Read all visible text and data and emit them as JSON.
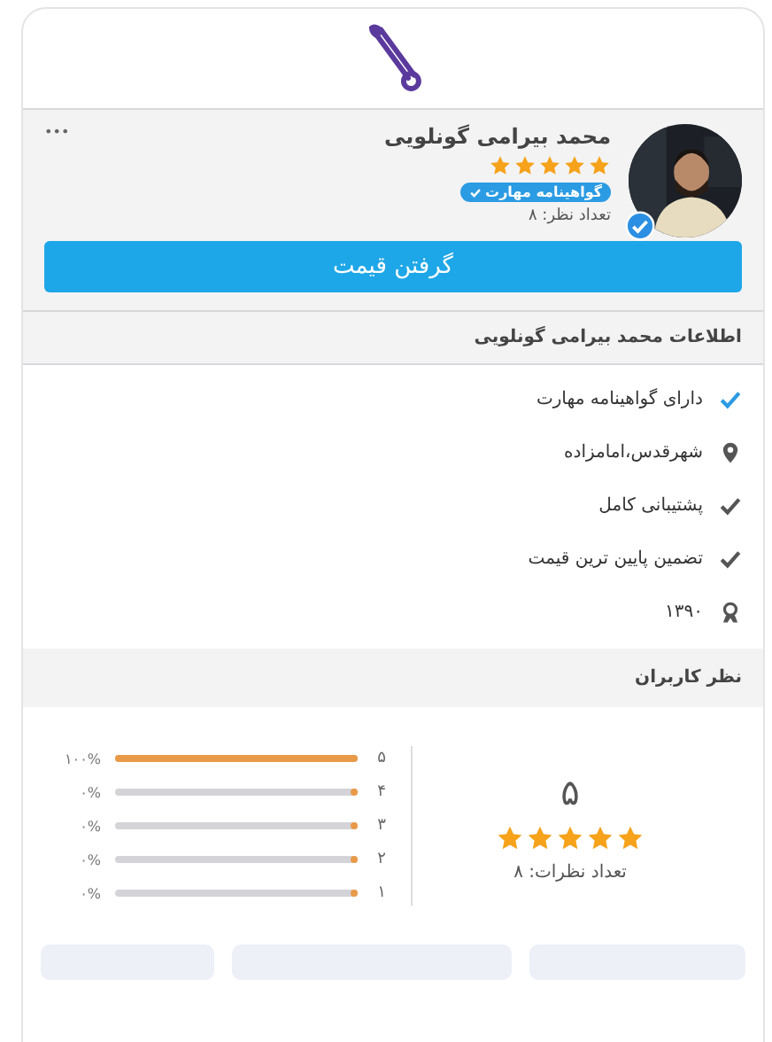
{
  "profile": {
    "name": "محمد بیرامی گونلویی",
    "stars": 5,
    "badge": "گواهینامه مهارت",
    "reviews_count": "تعداد نظر: ۸",
    "verified": true,
    "more": "•••",
    "button": "گرفتن قیمت"
  },
  "info": {
    "title": "اطلاعات محمد بیرامی گونلویی",
    "items": [
      {
        "kind": "verified",
        "text": "دارای گواهینامه مهارت"
      },
      {
        "kind": "location",
        "text": "شهرقدس،امامزاده"
      },
      {
        "kind": "check",
        "text": "پشتیبانی کامل"
      },
      {
        "kind": "check",
        "text": "تضمین پایین ترین قیمت"
      },
      {
        "kind": "since",
        "text": "۱۳۹۰"
      }
    ]
  },
  "reviews": {
    "title": "نظر کاربران",
    "score": "۵",
    "stars": 5,
    "count": "تعداد نظرات: ۸",
    "rows": [
      {
        "label": "۵",
        "level": 1,
        "percent": "۱۰۰%"
      },
      {
        "label": "۴",
        "level": 0,
        "percent": "۰%"
      },
      {
        "label": "۳",
        "level": 0,
        "percent": "۰%"
      },
      {
        "label": "۲",
        "level": 0,
        "percent": "۰%"
      },
      {
        "label": "۱",
        "level": 0,
        "percent": "۰%"
      }
    ]
  }
}
